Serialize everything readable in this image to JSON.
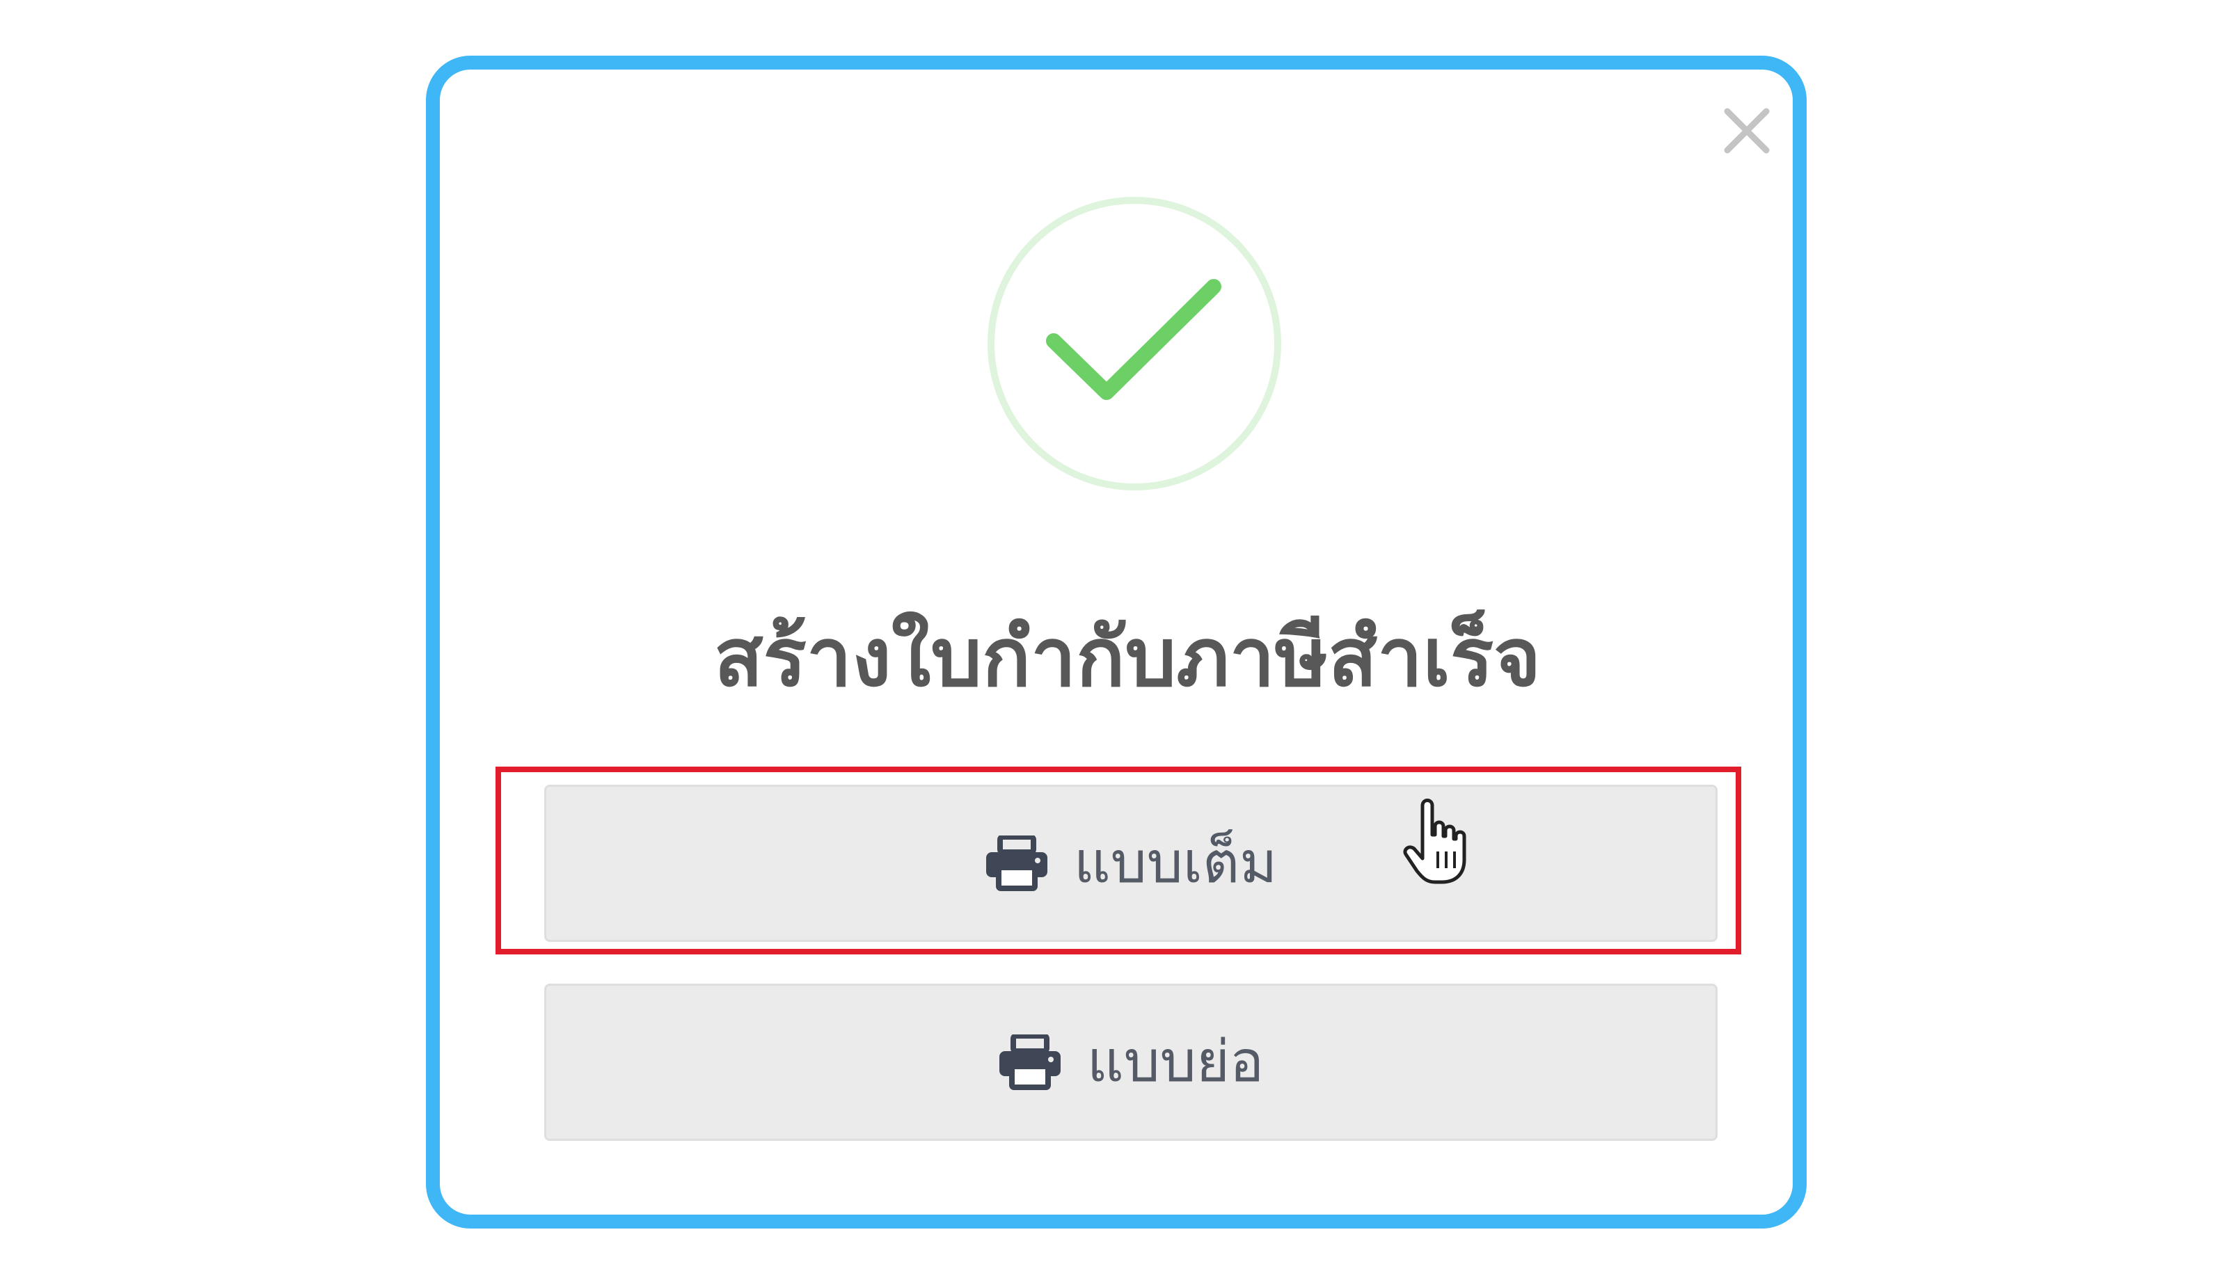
{
  "dialog": {
    "title": "สร้างใบกำกับภาษีสำเร็จ",
    "close_icon": "close-icon",
    "success_icon": "check-circle-icon",
    "buttons": [
      {
        "label": "แบบเต็ม",
        "icon": "printer-icon",
        "highlighted": true
      },
      {
        "label": "แบบย่อ",
        "icon": "printer-icon",
        "highlighted": false
      }
    ]
  },
  "colors": {
    "frame": "#3fb6f5",
    "success": "#6cd067",
    "success_ring": "#dff4dc",
    "highlight": "#e11d2b",
    "button_bg": "#ebebeb",
    "text": "#585858"
  },
  "cursor": "hand-pointer-icon"
}
